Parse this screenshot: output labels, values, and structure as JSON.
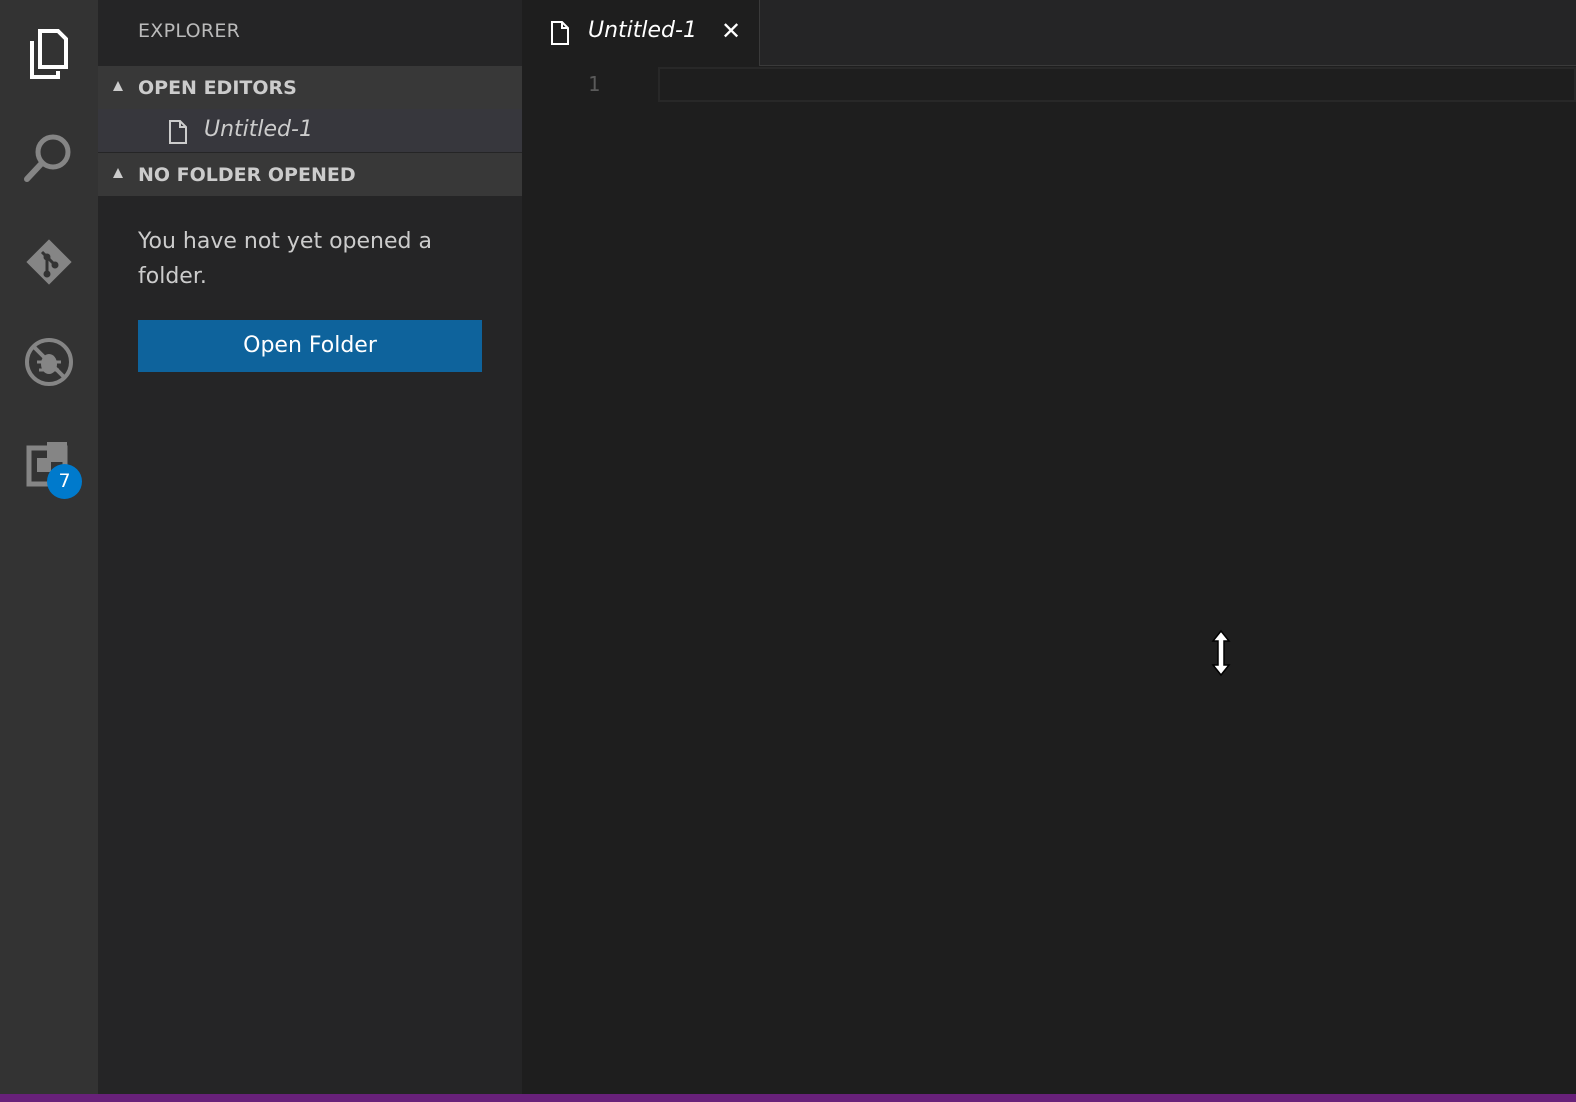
{
  "activity_bar": {
    "items": [
      {
        "icon": "files-icon",
        "active": true
      },
      {
        "icon": "search-icon",
        "active": false
      },
      {
        "icon": "git-icon",
        "active": false
      },
      {
        "icon": "debug-icon",
        "active": false
      },
      {
        "icon": "extensions-icon",
        "active": false,
        "badge": "7"
      }
    ]
  },
  "sidebar": {
    "title": "EXPLORER",
    "open_editors": {
      "label": "OPEN EDITORS",
      "items": [
        {
          "name": "Untitled-1"
        }
      ]
    },
    "no_folder": {
      "label": "NO FOLDER OPENED",
      "message": "You have not yet opened a folder.",
      "button_label": "Open Folder"
    }
  },
  "editor": {
    "tabs": [
      {
        "name": "Untitled-1",
        "close": "✕"
      }
    ],
    "line_numbers": [
      "1"
    ]
  },
  "colors": {
    "accent": "#0e639c",
    "badge": "#007acc",
    "status_bar": "#68217a"
  }
}
